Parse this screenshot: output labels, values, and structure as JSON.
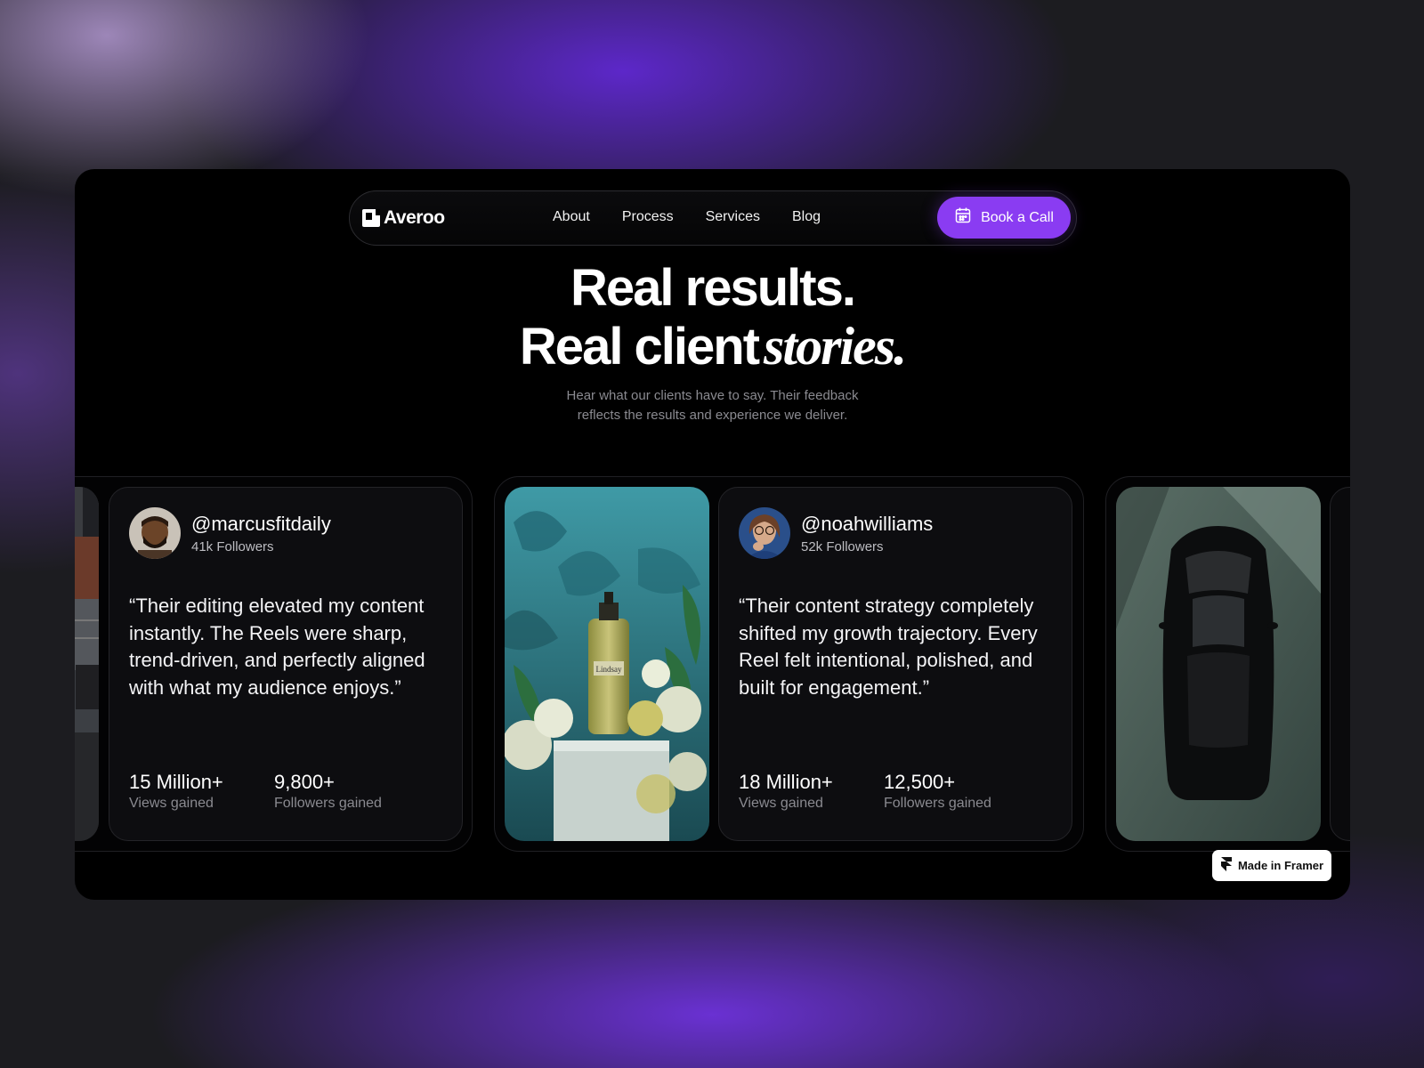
{
  "nav": {
    "brand": "Averoo",
    "links": [
      "About",
      "Process",
      "Services",
      "Blog"
    ],
    "cta": "Book a Call"
  },
  "hero": {
    "line1": "Real results.",
    "line2_regular": "Real client",
    "line2_italic": "stories.",
    "subtitle_line1": "Hear what our clients have to say. Their feedback",
    "subtitle_line2": "reflects the results and experience we deliver."
  },
  "testimonials": [
    {
      "handle": "@marcusfitdaily",
      "followers": "41k Followers",
      "quote": "“Their editing elevated my content instantly. The Reels were sharp, trend-driven, and perfectly aligned with what my audience enjoys.”",
      "stats": [
        {
          "value": "15 Million+",
          "label": "Views gained"
        },
        {
          "value": "9,800+",
          "label": "Followers gained"
        }
      ]
    },
    {
      "handle": "@noahwilliams",
      "followers": "52k Followers",
      "quote": "“Their content strategy completely shifted my growth trajectory. Every Reel felt intentional, polished, and built for engagement.”",
      "stats": [
        {
          "value": "18 Million+",
          "label": "Views gained"
        },
        {
          "value": "12,500+",
          "label": "Followers gained"
        }
      ]
    }
  ],
  "photos": {
    "bottle_label": "Lindsay"
  },
  "badge": "Made in Framer",
  "colors": {
    "accent": "#8a3cf2",
    "background": "#000000",
    "card": "#0d0d10"
  }
}
